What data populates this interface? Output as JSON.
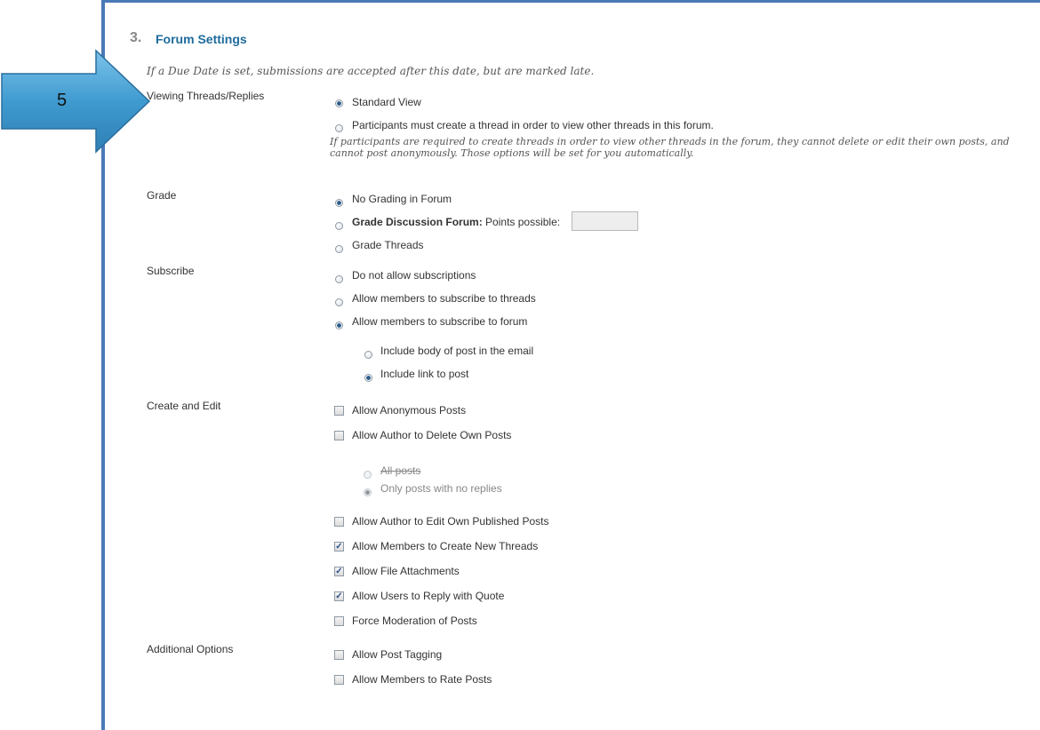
{
  "callout": {
    "number": "5",
    "color": "#4aa3d4"
  },
  "section": {
    "number": "3.",
    "title": "Forum Settings",
    "note": "If a Due Date is set, submissions are accepted after this date, but are marked late."
  },
  "viewing": {
    "label": "Viewing Threads/Replies",
    "options": [
      "Standard View",
      "Participants must create a thread in order to view other threads in this forum."
    ],
    "selected": 0,
    "help": "If participants are required to create threads in order to view other threads in the forum, they cannot delete or edit their own posts, and cannot post anonymously. Those options will be set for you automatically."
  },
  "grade": {
    "label": "Grade",
    "no_grading": "No Grading in Forum",
    "discussion_bold": "Grade Discussion Forum:",
    "points_possible": "Points possible:",
    "grade_threads": "Grade Threads",
    "points_value": ""
  },
  "subscribe": {
    "label": "Subscribe",
    "options": [
      "Do not allow subscriptions",
      "Allow members to subscribe to threads",
      "Allow members to subscribe to forum"
    ],
    "sub_options": [
      "Include body of post in the email",
      "Include link to post"
    ]
  },
  "create_edit": {
    "label": "Create and Edit",
    "anonymous": "Allow Anonymous Posts",
    "delete_own": "Allow Author to Delete Own Posts",
    "all_posts": "All posts",
    "no_replies": "Only posts with no replies",
    "edit_own": "Allow Author to Edit Own Published Posts",
    "new_threads": "Allow Members to Create New Threads",
    "file_attach": "Allow File Attachments",
    "reply_quote": "Allow Users to Reply with Quote",
    "moderation": "Force Moderation of Posts"
  },
  "additional": {
    "label": "Additional Options",
    "tagging": "Allow Post Tagging",
    "rate": "Allow Members to Rate Posts"
  },
  "colors": {
    "title": "#1e6b9c",
    "border": "#4a7ab8"
  }
}
